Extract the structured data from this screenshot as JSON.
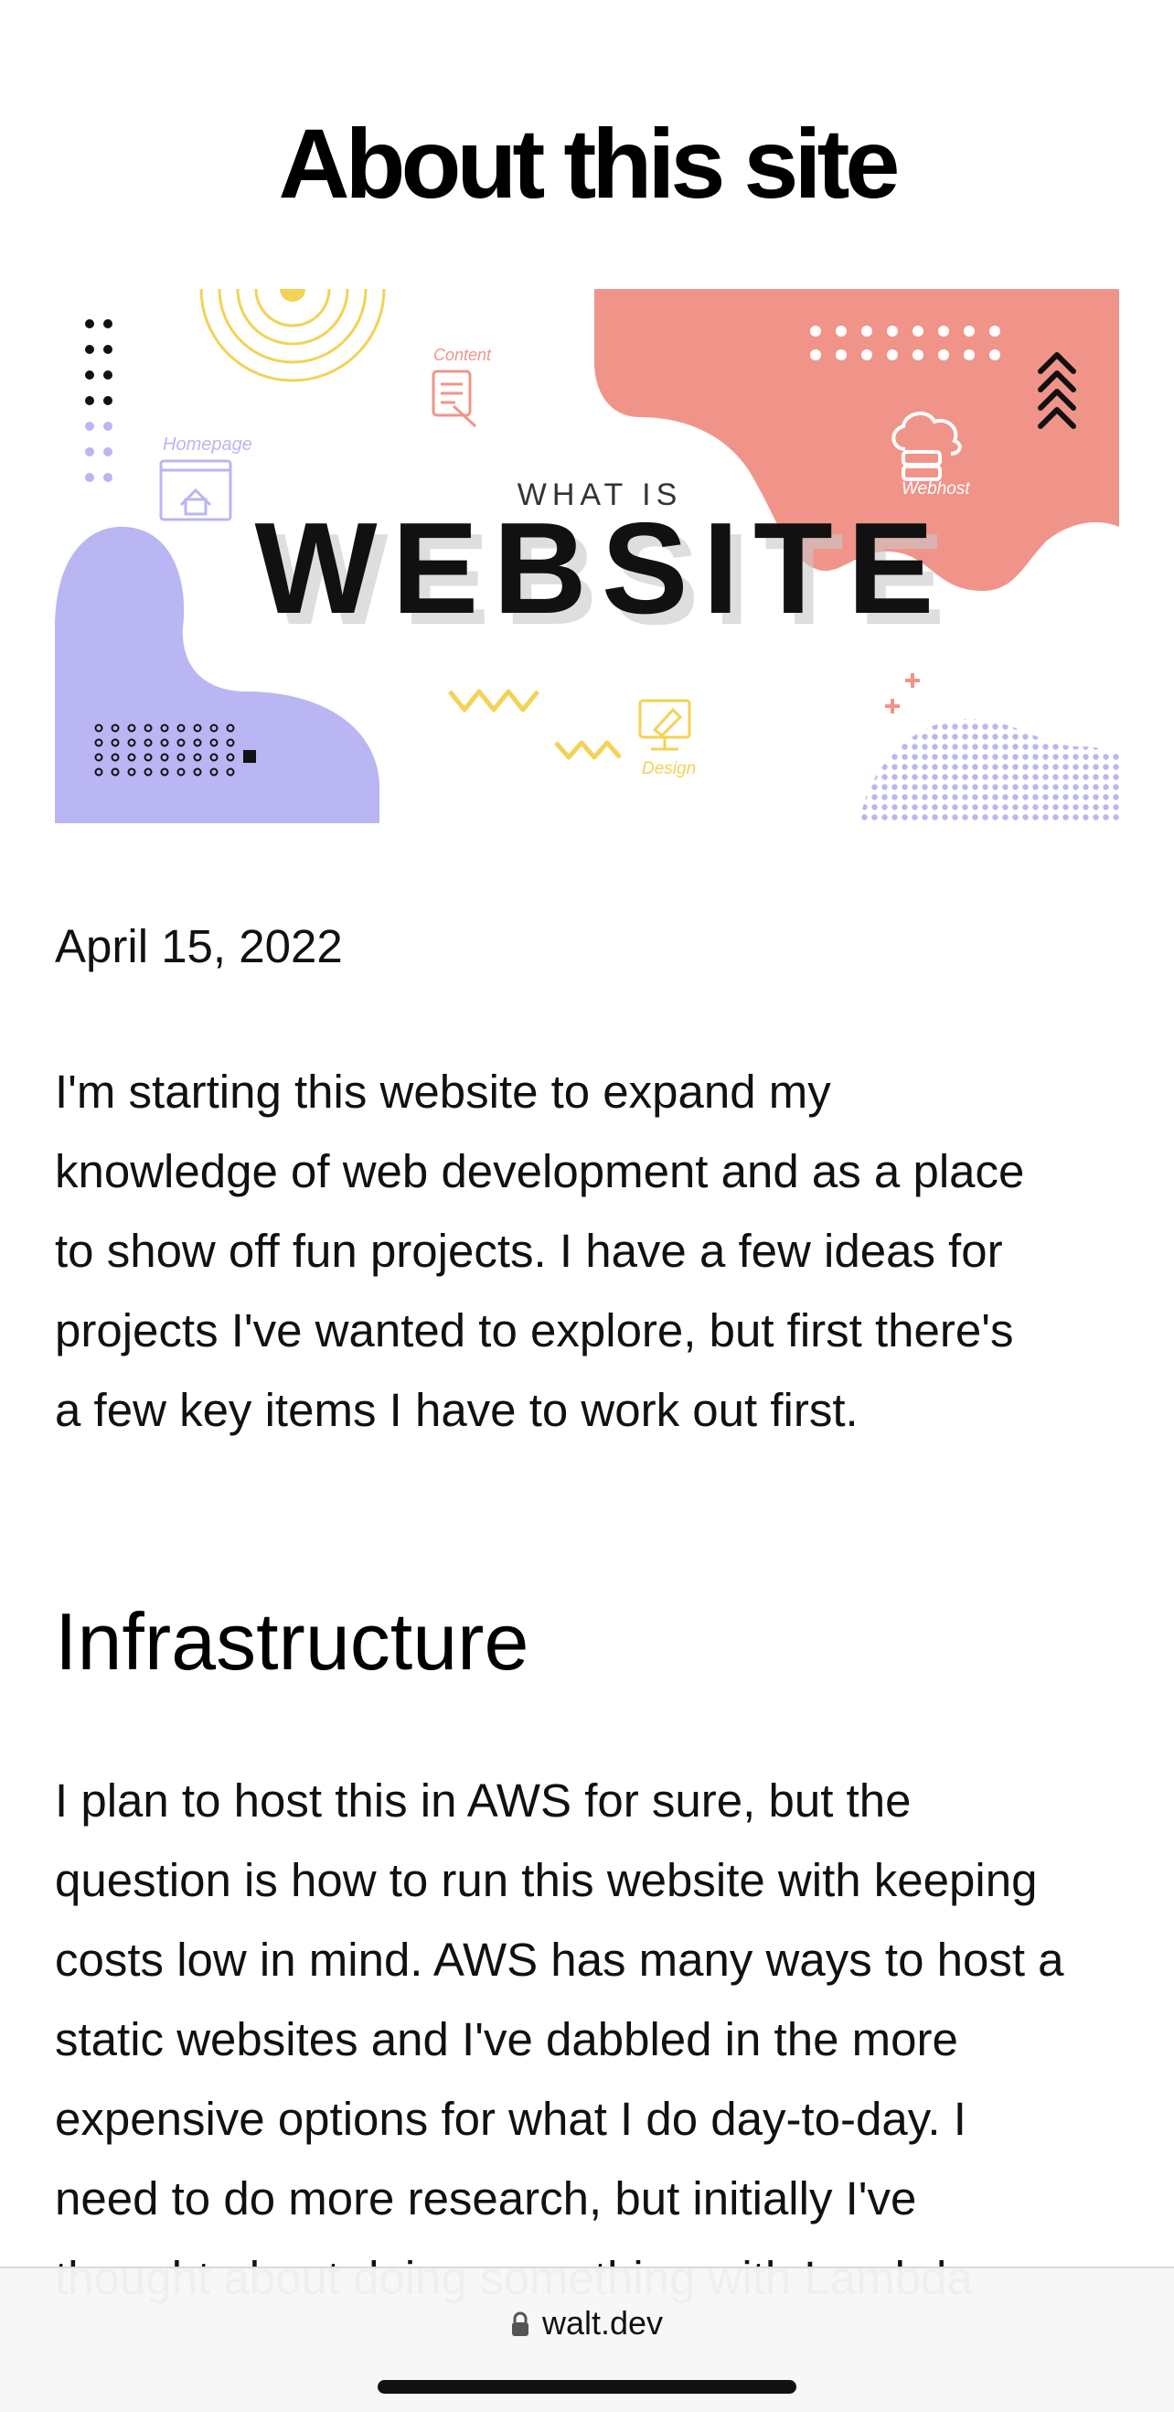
{
  "page": {
    "title": "About this site",
    "date": "April 15, 2022",
    "intro": "I'm starting this website to expand my\nknowledge of web development and as a place\nto show off fun projects. I have a few ideas for\nprojects I've wanted to explore, but first there's\na few key items I have to work out first.",
    "section_heading": "Infrastructure",
    "section_text": "I plan to host this in AWS for sure, but the\nquestion is how to run this website with keeping\ncosts low in mind. AWS has many ways to host a\nstatic websites and I've dabbled in the more\nexpensive options for what I do day-to-day. I\nneed to do more research, but initially I've\nthought about doing something with Lambda"
  },
  "hero_image": {
    "kicker": "WHAT IS",
    "headline": "WEBSITE",
    "labels": {
      "homepage": "Homepage",
      "content": "Content",
      "webhost": "Webhost",
      "design": "Design"
    },
    "colors": {
      "lavender": "#b9b6f3",
      "salmon": "#f0948a",
      "yellow": "#f3d255",
      "ink": "#111111"
    }
  },
  "browser": {
    "url": "walt.dev",
    "lock_icon": "lock-icon"
  }
}
